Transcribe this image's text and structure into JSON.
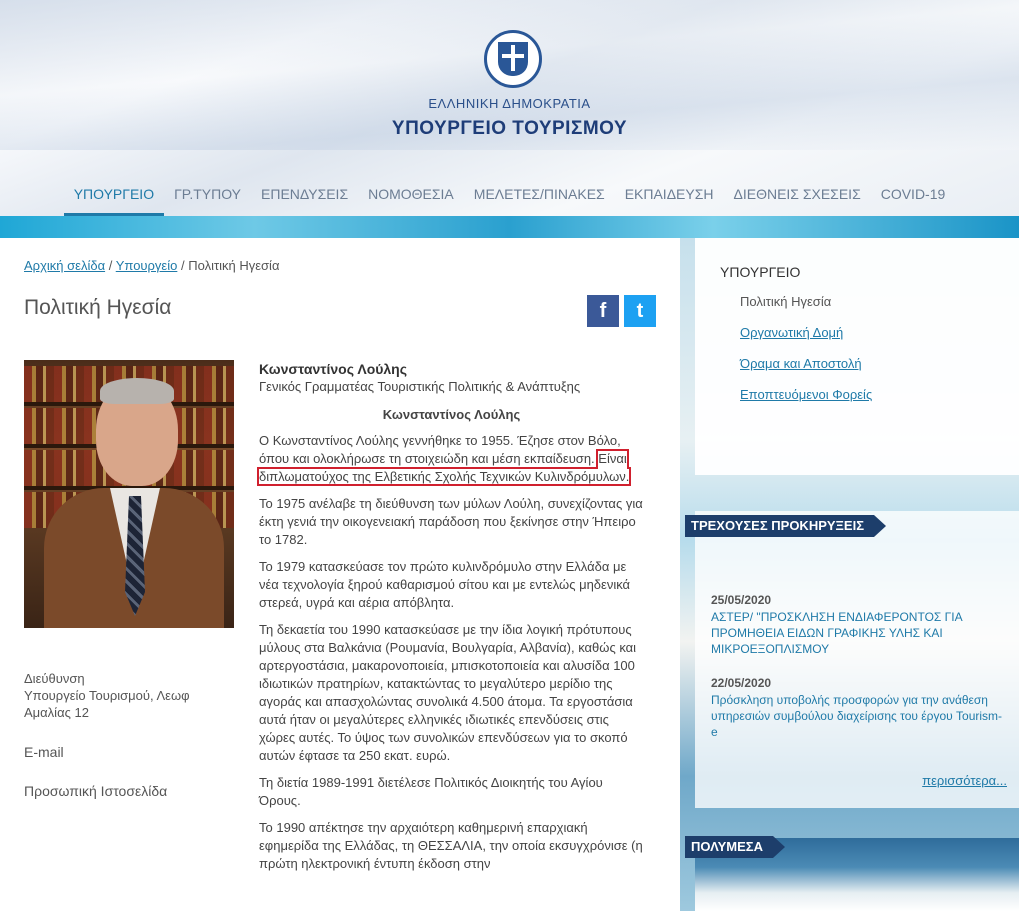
{
  "header": {
    "republic": "ΕΛΛΗΝΙΚΗ ΔΗΜΟΚΡΑΤΙΑ",
    "ministry": "ΥΠΟΥΡΓΕΙΟ ΤΟΥΡΙΣΜΟΥ"
  },
  "nav": {
    "items": [
      "ΥΠΟΥΡΓΕΙΟ",
      "ΓΡ.ΤΥΠΟΥ",
      "ΕΠΕΝΔΥΣΕΙΣ",
      "ΝΟΜΟΘΕΣΙΑ",
      "ΜΕΛΕΤΕΣ/ΠΙΝΑΚΕΣ",
      "ΕΚΠΑΙΔΕΥΣΗ",
      "ΔΙΕΘΝΕΙΣ ΣΧΕΣΕΙΣ",
      "COVID-19"
    ],
    "active_index": 0
  },
  "breadcrumb": {
    "home": "Αρχική σελίδα",
    "sep": "/",
    "section": "Υπουργείο",
    "current": "Πολιτική Ηγεσία"
  },
  "page_title": "Πολιτική Ηγεσία",
  "social": {
    "facebook": "f",
    "twitter": "t"
  },
  "contact": {
    "title": "Διεύθυνση",
    "address": "Υπουργείο Τουρισμού, Λεωφ Αμαλίας 12",
    "email": "E-mail",
    "website": "Προσωπική Ιστοσελίδα"
  },
  "bio": {
    "name": "Κωνσταντίνος Λούλης",
    "role": "Γενικός Γραμματέας Τουριστικής Πολιτικής & Ανάπτυξης",
    "center_name": "Κωνσταντίνος Λούλης",
    "p1_a": "Ο Κωνσταντίνος Λούλης γεννήθηκε το 1955. Έζησε στον Βόλο, όπου και ολοκλήρωσε τη στοιχειώδη και μέση εκπαίδευση.",
    "p1_b": "Είναι διπλωματούχος της Ελβετικής Σχολής Τεχνικών Κυλινδρόμυλων.",
    "p2": "Το 1975 ανέλαβε τη διεύθυνση των μύλων Λούλη, συνεχίζοντας για έκτη γενιά την οικογενειακή παράδοση που ξεκίνησε στην Ήπειρο το 1782.",
    "p3": "Το 1979 κατασκεύασε τον πρώτο κυλινδρόμυλο στην Ελλάδα με νέα τεχνολογία ξηρού καθαρισμού σίτου και με εντελώς μηδενικά στερεά, υγρά και αέρια απόβλητα.",
    "p4": "Τη δεκαετία του 1990 κατασκεύασε με την ίδια λογική πρότυπους μύλους στα Βαλκάνια (Ρουμανία, Βουλγαρία, Αλβανία), καθώς και αρτεργοστάσια, μακαρονοποιεία, μπισκοτοποιεία και αλυσίδα 100 ιδιωτικών πρατηρίων, κατακτώντας το μεγαλύτερο μερίδιο της αγοράς και απασχολώντας συνολικά 4.500 άτομα. Τα εργοστάσια αυτά ήταν οι μεγαλύτερες ελληνικές ιδιωτικές επενδύσεις στις χώρες αυτές. Το ύψος των συνολικών επενδύσεων για το σκοπό αυτών έφτασε τα 250 εκατ. ευρώ.",
    "p5": "Τη διετία 1989-1991 διετέλεσε Πολιτικός Διοικητής του Αγίου Όρους.",
    "p6": "Το 1990 απέκτησε την αρχαιότερη καθημερινή επαρχιακή εφημερίδα της Ελλάδας, τη ΘΕΣΣΑΛΙΑ, την οποία εκσυγχρόνισε (η πρώτη ηλεκτρονική έντυπη έκδοση στην"
  },
  "sidebar": {
    "title": "ΥΠΟΥΡΓΕΙΟ",
    "current": "Πολιτική Ηγεσία",
    "links": [
      "Οργανωτική Δομή",
      "Όραμα και Αποστολή",
      "Εποπτευόμενοι Φορείς"
    ]
  },
  "tenders": {
    "heading": "ΤΡΕΧΟΥΣΕΣ ΠΡΟΚΗΡΥΞΕΙΣ",
    "items": [
      {
        "date": "25/05/2020",
        "text": "ΑΣΤΕΡ/ \"ΠΡΟΣΚΛΗΣΗ ΕΝΔΙΑΦΕΡΟΝΤΟΣ ΓΙΑ ΠΡΟΜΗΘΕΙΑ ΕΙΔΩΝ ΓΡΑΦΙΚΗΣ ΥΛΗΣ ΚΑΙ ΜΙΚΡΟΕΞΟΠΛΙΣΜΟΥ"
      },
      {
        "date": "22/05/2020",
        "text": "Πρόσκληση υποβολής προσφορών για την ανάθεση υπηρεσιών συμβούλου διαχείρισης του έργου Tourism-e"
      }
    ],
    "more": "περισσότερα..."
  },
  "media": {
    "heading": "ΠΟΛΥΜΕΣΑ"
  },
  "colors": {
    "accent": "#1f7aa8",
    "navy": "#1d3e6b",
    "highlight": "#d0202e"
  }
}
